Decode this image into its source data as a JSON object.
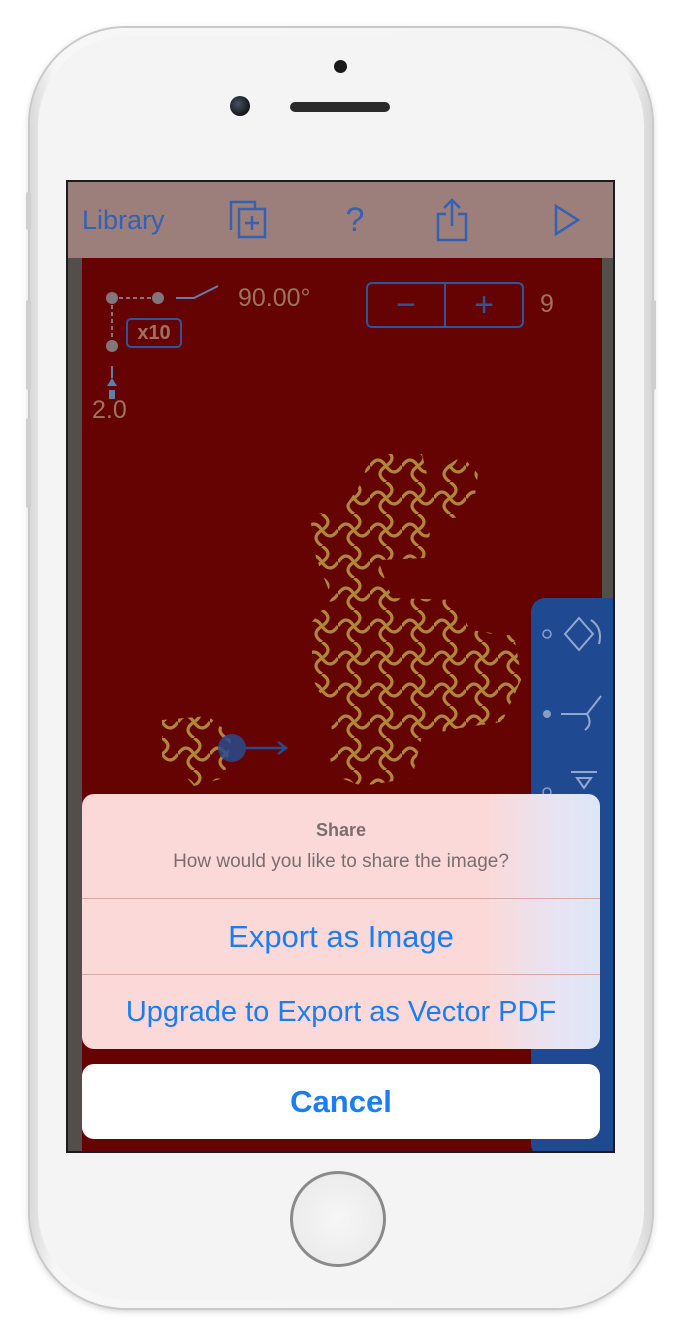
{
  "toolbar": {
    "library_label": "Library",
    "icons": [
      "duplicate-icon",
      "help-icon",
      "share-icon",
      "play-icon"
    ],
    "help_glyph": "?"
  },
  "controls": {
    "angle": "90.00°",
    "multiplier": "x10",
    "length": "2.0",
    "stepper_minus": "−",
    "stepper_plus": "+",
    "iterations": "9"
  },
  "side_panel": {
    "icons": [
      "rotate-icon",
      "angle-tool-icon",
      "scale-tool-icon"
    ]
  },
  "action_sheet": {
    "title": "Share",
    "message": "How would you like to share the image?",
    "actions": [
      {
        "label": "Export as Image"
      },
      {
        "label": "Upgrade to Export as Vector PDF"
      }
    ],
    "cancel_label": "Cancel"
  },
  "colors": {
    "accent": "#1a7df2",
    "canvas": "#6b0000",
    "curve": "#b9913c",
    "toolbar_tint": "#3566c0"
  }
}
